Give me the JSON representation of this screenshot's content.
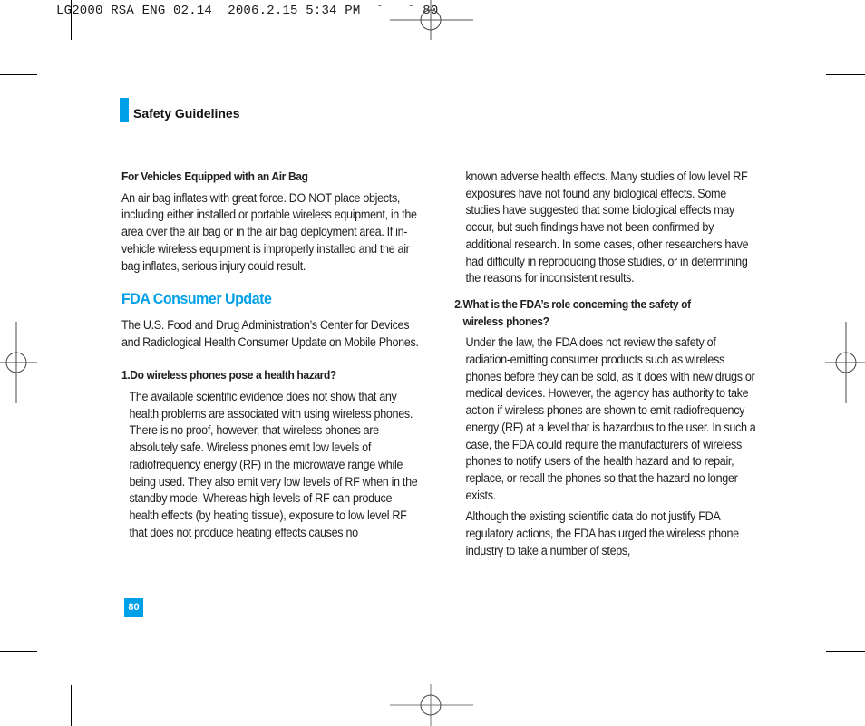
{
  "print_slug": {
    "text": "LG2000 RSA ENG_02.14  2006.2.15 5:34 PM",
    "glyphs": "˘   ˘",
    "page": "80"
  },
  "header": {
    "section_title": "Safety Guidelines",
    "accent_color": "#00a0e9"
  },
  "left_column": {
    "airbag_heading": "For Vehicles Equipped with an Air Bag",
    "airbag_body": "An air bag inflates with great force. DO NOT place objects, including either installed or portable wireless equipment, in the area over the air bag or in the air bag deployment area. If in-vehicle wireless equipment is improperly installed and the air bag inflates, serious injury could result.",
    "fda_heading": "FDA Consumer Update",
    "fda_intro": "The U.S. Food and Drug Administration’s Center for Devices and Radiological Health Consumer Update on Mobile Phones.",
    "q1_heading": "1.Do wireless phones pose a health hazard?",
    "q1_body": "The available scientific evidence does not show that any health problems are associated with using wireless phones. There is no proof, however, that wireless phones are absolutely safe. Wireless phones emit low levels of radiofrequency energy (RF) in the microwave range while being used. They also emit very low levels of RF when in the standby mode. Whereas high levels of RF can produce health effects (by heating tissue), exposure to low level RF that does not produce heating effects causes no"
  },
  "right_column": {
    "q1_body_cont": "known adverse health effects. Many studies of low level RF exposures have not found any biological effects. Some studies have suggested that some biological effects may occur, but such findings have not been confirmed by additional research. In some cases, other researchers have had difficulty in reproducing those studies, or in determining the reasons for inconsistent results.",
    "q2_heading_line1": "2.What is the FDA’s role concerning the safety of",
    "q2_heading_line2": "wireless phones?",
    "q2_body1": "Under the law, the FDA does not review the safety of radiation-emitting consumer products such as wireless phones before they can be sold, as it does with new drugs or medical devices. However, the agency has authority to take action if wireless phones are shown to emit radiofrequency energy (RF) at a level that is hazardous to the user. In such a case, the FDA could require the manufacturers of wireless phones to notify users of the health hazard and to repair, replace, or recall the phones so that the hazard no longer exists.",
    "q2_body2": "Although the existing scientific data do not justify FDA regulatory actions, the FDA has urged the wireless phone industry to take a number of steps,"
  },
  "footer": {
    "page_number": "80"
  }
}
